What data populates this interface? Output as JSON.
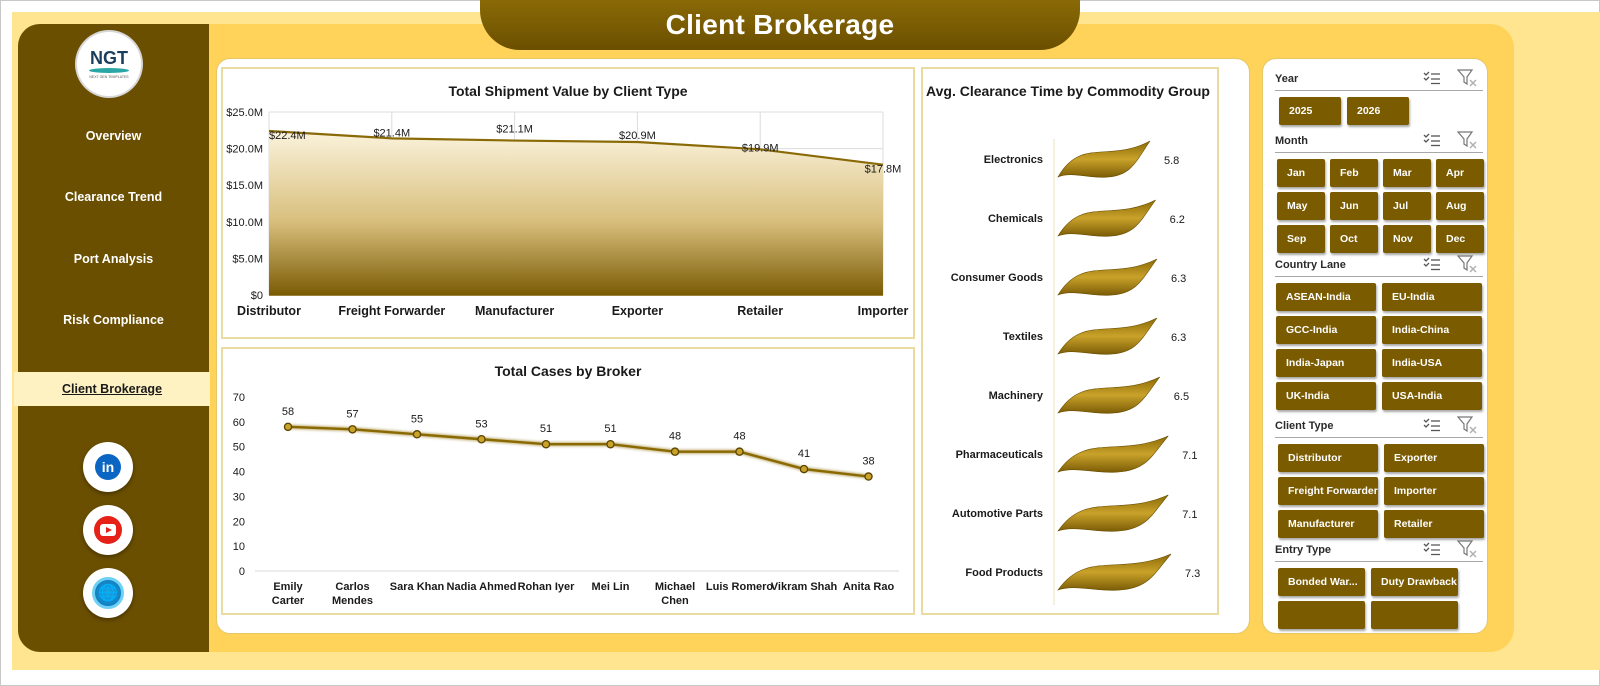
{
  "title": "Client Brokerage",
  "logo": {
    "text": "NGT",
    "tagline": "NEXT GEN TEMPLATES"
  },
  "nav": [
    {
      "label": "Overview",
      "active": false
    },
    {
      "label": "Clearance Trend",
      "active": false
    },
    {
      "label": "Port Analysis",
      "active": false
    },
    {
      "label": "Risk Compliance",
      "active": false
    },
    {
      "label": "Client Brokerage",
      "active": true
    }
  ],
  "social": [
    {
      "icon": "linkedin-icon",
      "glyph": "in"
    },
    {
      "icon": "youtube-icon"
    },
    {
      "icon": "globe-icon",
      "glyph": "🌐"
    }
  ],
  "colors": {
    "brown": "#6b4f00",
    "gold": "#ffd35a",
    "line": "#8a6a06",
    "button": "#7a5b00"
  },
  "chart_data": [
    {
      "type": "area",
      "title": "Total Shipment Value by Client Type",
      "categories": [
        "Distributor",
        "Freight Forwarder",
        "Manufacturer",
        "Exporter",
        "Retailer",
        "Importer"
      ],
      "values": [
        22.4,
        21.4,
        21.1,
        20.9,
        19.9,
        17.8
      ],
      "data_labels": [
        "$22.4M",
        "$21.4M",
        "$21.1M",
        "$20.9M",
        "$19.9M",
        "$17.8M"
      ],
      "y_ticks": [
        "$0",
        "$5.0M",
        "$10.0M",
        "$15.0M",
        "$20.0M",
        "$25.0M"
      ],
      "ylim": [
        0,
        25
      ],
      "grid": true
    },
    {
      "type": "line",
      "title": "Total Cases by Broker",
      "categories": [
        "Emily Carter",
        "Carlos Mendes",
        "Sara Khan",
        "Nadia Ahmed",
        "Rohan Iyer",
        "Mei Lin",
        "Michael Chen",
        "Luis Romero",
        "Vikram Shah",
        "Anita Rao"
      ],
      "values": [
        58,
        57,
        55,
        53,
        51,
        51,
        48,
        48,
        41,
        38
      ],
      "y_ticks": [
        "0",
        "10",
        "20",
        "30",
        "40",
        "50",
        "60",
        "70"
      ],
      "ylim": [
        0,
        70
      ],
      "grid": false
    },
    {
      "type": "bar",
      "title": "Avg. Clearance Time by Commodity Group",
      "categories": [
        "Electronics",
        "Chemicals",
        "Consumer Goods",
        "Textiles",
        "Machinery",
        "Pharmaceuticals",
        "Automotive Parts",
        "Food Products"
      ],
      "values": [
        5.8,
        6.2,
        6.3,
        6.3,
        6.5,
        7.1,
        7.1,
        7.3
      ],
      "orientation": "horizontal"
    }
  ],
  "slicers": [
    {
      "label": "Year",
      "items": [
        "2025",
        "2026"
      ]
    },
    {
      "label": "Month",
      "items": [
        "Jan",
        "Feb",
        "Mar",
        "Apr",
        "May",
        "Jun",
        "Jul",
        "Aug",
        "Sep",
        "Oct",
        "Nov",
        "Dec"
      ]
    },
    {
      "label": "Country Lane",
      "items": [
        "ASEAN-India",
        "EU-India",
        "GCC-India",
        "India-China",
        "India-Japan",
        "India-USA",
        "UK-India",
        "USA-India"
      ]
    },
    {
      "label": "Client Type",
      "items": [
        "Distributor",
        "Exporter",
        "Freight Forwarder",
        "Importer",
        "Manufacturer",
        "Retailer"
      ]
    },
    {
      "label": "Entry Type",
      "items": [
        "Bonded War...",
        "Duty Drawback",
        "",
        ""
      ]
    }
  ]
}
